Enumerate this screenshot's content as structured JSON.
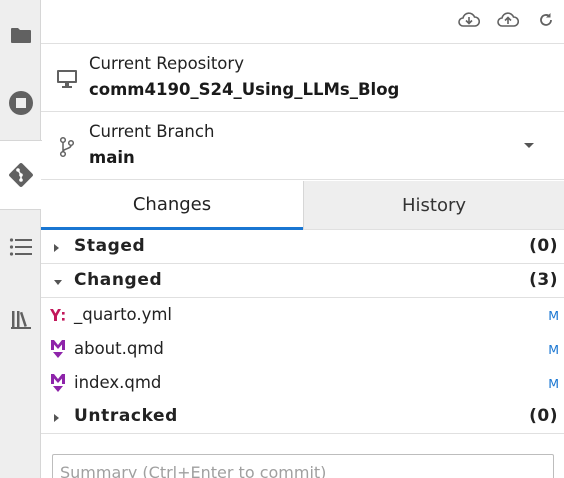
{
  "colors": {
    "accent": "#1976d2",
    "markdown_purple": "#8e24aa",
    "yaml_pink": "#c2185b"
  },
  "sidebar": {
    "items": [
      {
        "name": "folder",
        "icon": "folder-icon"
      },
      {
        "name": "running",
        "icon": "stop-circle-icon"
      },
      {
        "name": "git",
        "icon": "git-icon",
        "active": true
      },
      {
        "name": "table-of-contents",
        "icon": "list-icon"
      },
      {
        "name": "extensions",
        "icon": "library-icon"
      }
    ]
  },
  "toolbar": {
    "buttons": [
      {
        "name": "pull",
        "icon": "cloud-download-icon"
      },
      {
        "name": "push",
        "icon": "cloud-upload-icon"
      },
      {
        "name": "refresh",
        "icon": "refresh-icon"
      }
    ]
  },
  "repository": {
    "label": "Current Repository",
    "value": "comm4190_S24_Using_LLMs_Blog"
  },
  "branch": {
    "label": "Current Branch",
    "value": "main"
  },
  "tabs": [
    {
      "label": "Changes",
      "selected": true
    },
    {
      "label": "History",
      "selected": false
    }
  ],
  "groups": {
    "staged": {
      "name": "Staged",
      "count": "(0)"
    },
    "changed": {
      "name": "Changed",
      "count": "(3)",
      "files": [
        {
          "name": "_quarto.yml",
          "status": "M",
          "icon": "yaml-icon"
        },
        {
          "name": "about.qmd",
          "status": "M",
          "icon": "markdown-icon"
        },
        {
          "name": "index.qmd",
          "status": "M",
          "icon": "markdown-icon"
        }
      ]
    },
    "untracked": {
      "name": "Untracked",
      "count": "(0)"
    }
  },
  "commit": {
    "summary_placeholder": "Summary (Ctrl+Enter to commit)"
  }
}
